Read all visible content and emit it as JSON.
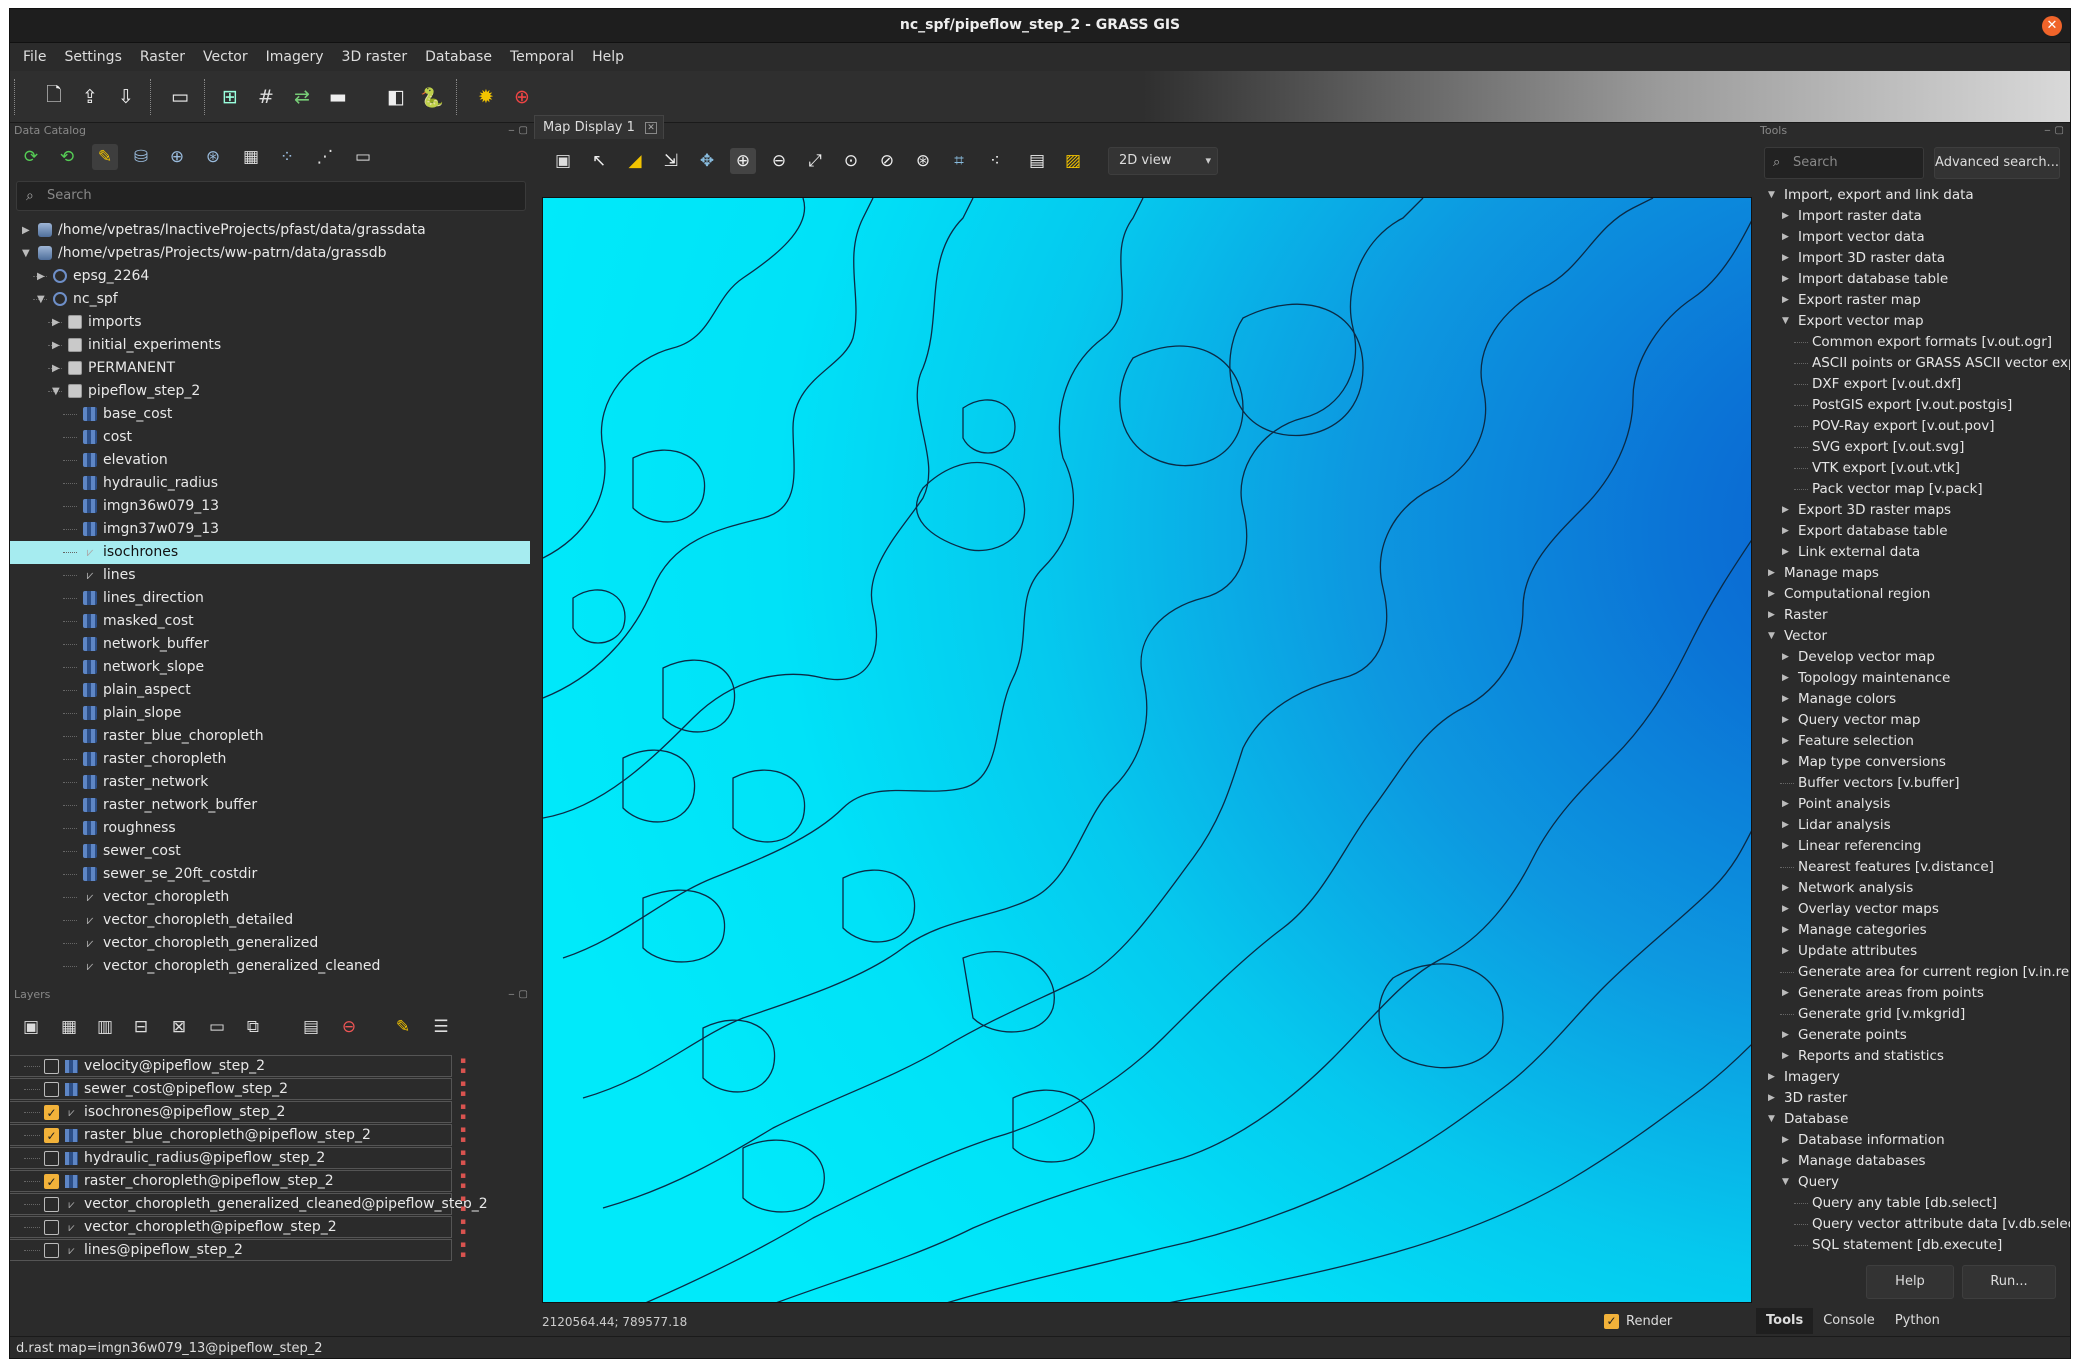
{
  "window": {
    "title": "nc_spf/pipeflow_step_2 - GRASS GIS",
    "close_label": "✕"
  },
  "menu": [
    "File",
    "Settings",
    "Raster",
    "Vector",
    "Imagery",
    "3D raster",
    "Database",
    "Temporal",
    "Help"
  ],
  "data_catalog": {
    "panel_title": "Data Catalog",
    "search_placeholder": "Search",
    "rows": [
      {
        "label": "/home/vpetras/InactiveProjects/pfast/data/grassdata",
        "level": 0,
        "kind": "db",
        "expanded": false
      },
      {
        "label": "/home/vpetras/Projects/ww-patrn/data/grassdb",
        "level": 0,
        "kind": "db",
        "expanded": true
      },
      {
        "label": "epsg_2264",
        "level": 1,
        "kind": "loc",
        "expanded": false
      },
      {
        "label": "nc_spf",
        "level": 1,
        "kind": "loc",
        "expanded": true
      },
      {
        "label": "imports",
        "level": 2,
        "kind": "ms",
        "expanded": false
      },
      {
        "label": "initial_experiments",
        "level": 2,
        "kind": "ms",
        "expanded": false
      },
      {
        "label": "PERMANENT",
        "level": 2,
        "kind": "ms",
        "expanded": false
      },
      {
        "label": "pipeflow_step_2",
        "level": 2,
        "kind": "ms",
        "expanded": true
      },
      {
        "label": "base_cost",
        "level": 3,
        "kind": "rast"
      },
      {
        "label": "cost",
        "level": 3,
        "kind": "rast"
      },
      {
        "label": "elevation",
        "level": 3,
        "kind": "rast"
      },
      {
        "label": "hydraulic_radius",
        "level": 3,
        "kind": "rast"
      },
      {
        "label": "imgn36w079_13",
        "level": 3,
        "kind": "rast"
      },
      {
        "label": "imgn37w079_13",
        "level": 3,
        "kind": "rast"
      },
      {
        "label": "isochrones",
        "level": 3,
        "kind": "vect",
        "selected": true
      },
      {
        "label": "lines",
        "level": 3,
        "kind": "vect"
      },
      {
        "label": "lines_direction",
        "level": 3,
        "kind": "rast"
      },
      {
        "label": "masked_cost",
        "level": 3,
        "kind": "rast"
      },
      {
        "label": "network_buffer",
        "level": 3,
        "kind": "rast"
      },
      {
        "label": "network_slope",
        "level": 3,
        "kind": "rast"
      },
      {
        "label": "plain_aspect",
        "level": 3,
        "kind": "rast"
      },
      {
        "label": "plain_slope",
        "level": 3,
        "kind": "rast"
      },
      {
        "label": "raster_blue_choropleth",
        "level": 3,
        "kind": "rast"
      },
      {
        "label": "raster_choropleth",
        "level": 3,
        "kind": "rast"
      },
      {
        "label": "raster_network",
        "level": 3,
        "kind": "rast"
      },
      {
        "label": "raster_network_buffer",
        "level": 3,
        "kind": "rast"
      },
      {
        "label": "roughness",
        "level": 3,
        "kind": "rast"
      },
      {
        "label": "sewer_cost",
        "level": 3,
        "kind": "rast"
      },
      {
        "label": "sewer_se_20ft_costdir",
        "level": 3,
        "kind": "rast"
      },
      {
        "label": "vector_choropleth",
        "level": 3,
        "kind": "vect"
      },
      {
        "label": "vector_choropleth_detailed",
        "level": 3,
        "kind": "vect"
      },
      {
        "label": "vector_choropleth_generalized",
        "level": 3,
        "kind": "vect"
      },
      {
        "label": "vector_choropleth_generalized_cleaned",
        "level": 3,
        "kind": "vect"
      }
    ]
  },
  "layers": {
    "panel_title": "Layers",
    "items": [
      {
        "label": "velocity@pipeflow_step_2",
        "checked": false,
        "kind": "rast"
      },
      {
        "label": "sewer_cost@pipeflow_step_2",
        "checked": false,
        "kind": "rast"
      },
      {
        "label": "isochrones@pipeflow_step_2",
        "checked": true,
        "kind": "vect"
      },
      {
        "label": "raster_blue_choropleth@pipeflow_step_2",
        "checked": true,
        "kind": "rast"
      },
      {
        "label": "hydraulic_radius@pipeflow_step_2",
        "checked": false,
        "kind": "rast"
      },
      {
        "label": "raster_choropleth@pipeflow_step_2",
        "checked": true,
        "kind": "rast"
      },
      {
        "label": "vector_choropleth_generalized_cleaned@pipeflow_step_2",
        "checked": false,
        "kind": "vect"
      },
      {
        "label": "vector_choropleth@pipeflow_step_2",
        "checked": false,
        "kind": "vect"
      },
      {
        "label": "lines@pipeflow_step_2",
        "checked": false,
        "kind": "vect"
      }
    ]
  },
  "map_display": {
    "tab_label": "Map Display 1",
    "view_mode": "2D view",
    "coordinates": "2120564.44; 789577.18",
    "render_label": "Render",
    "render_checked": true
  },
  "tools": {
    "panel_title": "Tools",
    "search_placeholder": "Search",
    "advanced_search_label": "Advanced search...",
    "help_label": "Help",
    "run_label": "Run...",
    "tree": [
      {
        "label": "Import, export and link data",
        "level": 0,
        "expanded": true
      },
      {
        "label": "Import raster data",
        "level": 1,
        "expanded": false
      },
      {
        "label": "Import vector data",
        "level": 1,
        "expanded": false
      },
      {
        "label": "Import 3D raster data",
        "level": 1,
        "expanded": false
      },
      {
        "label": "Import database table",
        "level": 1,
        "expanded": false
      },
      {
        "label": "Export raster map",
        "level": 1,
        "expanded": false
      },
      {
        "label": "Export vector map",
        "level": 1,
        "expanded": true
      },
      {
        "label": "Common export formats   [v.out.ogr]",
        "level": 2
      },
      {
        "label": "ASCII points or GRASS ASCII vector expor",
        "level": 2
      },
      {
        "label": "DXF export   [v.out.dxf]",
        "level": 2
      },
      {
        "label": "PostGIS export   [v.out.postgis]",
        "level": 2
      },
      {
        "label": "POV-Ray export   [v.out.pov]",
        "level": 2
      },
      {
        "label": "SVG export   [v.out.svg]",
        "level": 2
      },
      {
        "label": "VTK export   [v.out.vtk]",
        "level": 2
      },
      {
        "label": "Pack vector map   [v.pack]",
        "level": 2
      },
      {
        "label": "Export 3D raster maps",
        "level": 1,
        "expanded": false
      },
      {
        "label": "Export database table",
        "level": 1,
        "expanded": false
      },
      {
        "label": "Link external data",
        "level": 1,
        "expanded": false
      },
      {
        "label": "Manage maps",
        "level": 0,
        "expanded": false
      },
      {
        "label": "Computational region",
        "level": 0,
        "expanded": false
      },
      {
        "label": "Raster",
        "level": 0,
        "expanded": false
      },
      {
        "label": "Vector",
        "level": 0,
        "expanded": true
      },
      {
        "label": "Develop vector map",
        "level": 1,
        "expanded": false
      },
      {
        "label": "Topology maintenance",
        "level": 1,
        "expanded": false
      },
      {
        "label": "Manage colors",
        "level": 1,
        "expanded": false
      },
      {
        "label": "Query vector map",
        "level": 1,
        "expanded": false
      },
      {
        "label": "Feature selection",
        "level": 1,
        "expanded": false
      },
      {
        "label": "Map type conversions",
        "level": 1,
        "expanded": false
      },
      {
        "label": "Buffer vectors   [v.buffer]",
        "level": 1
      },
      {
        "label": "Point analysis",
        "level": 1,
        "expanded": false
      },
      {
        "label": "Lidar analysis",
        "level": 1,
        "expanded": false
      },
      {
        "label": "Linear referencing",
        "level": 1,
        "expanded": false
      },
      {
        "label": "Nearest features   [v.distance]",
        "level": 1
      },
      {
        "label": "Network analysis",
        "level": 1,
        "expanded": false
      },
      {
        "label": "Overlay vector maps",
        "level": 1,
        "expanded": false
      },
      {
        "label": "Manage categories",
        "level": 1,
        "expanded": false
      },
      {
        "label": "Update attributes",
        "level": 1,
        "expanded": false
      },
      {
        "label": "Generate area for current region   [v.in.regio",
        "level": 1
      },
      {
        "label": "Generate areas from points",
        "level": 1,
        "expanded": false
      },
      {
        "label": "Generate grid   [v.mkgrid]",
        "level": 1
      },
      {
        "label": "Generate points",
        "level": 1,
        "expanded": false
      },
      {
        "label": "Reports and statistics",
        "level": 1,
        "expanded": false
      },
      {
        "label": "Imagery",
        "level": 0,
        "expanded": false
      },
      {
        "label": "3D raster",
        "level": 0,
        "expanded": false
      },
      {
        "label": "Database",
        "level": 0,
        "expanded": true
      },
      {
        "label": "Database information",
        "level": 1,
        "expanded": false
      },
      {
        "label": "Manage databases",
        "level": 1,
        "expanded": false
      },
      {
        "label": "Query",
        "level": 1,
        "expanded": true
      },
      {
        "label": "Query any table   [db.select]",
        "level": 2
      },
      {
        "label": "Query vector attribute data   [v.db.select",
        "level": 2
      },
      {
        "label": "SQL statement   [db.execute]",
        "level": 2
      }
    ],
    "tabs": [
      "Tools",
      "Console",
      "Python"
    ],
    "active_tab": "Tools"
  },
  "status_bar": "d.rast map=imgn36w079_13@pipeflow_step_2",
  "colors": {
    "selection": "#a6ecf0",
    "checkbox": "#f2b23a",
    "map_light": "#00eafa",
    "map_dark": "#0a5ccf",
    "close": "#f0642a"
  }
}
